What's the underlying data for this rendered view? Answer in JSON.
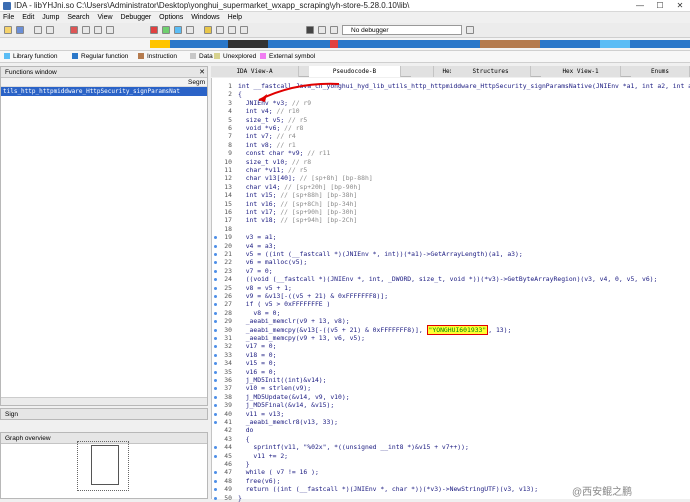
{
  "window": {
    "title": "IDA - libYHJni.so C:\\Users\\Administrator\\Desktop\\yonghui_supermarket_wxapp_scraping\\yh-store-5.28.0.10\\lib\\",
    "buttons": [
      "—",
      "☐",
      "✕"
    ]
  },
  "menu": [
    "File",
    "Edit",
    "Jump",
    "Search",
    "View",
    "Debugger",
    "Options",
    "Windows",
    "Help"
  ],
  "toolbar": {
    "debugger_select": "No debugger"
  },
  "legend": [
    {
      "label": "Library function",
      "color": "#5bbdf5"
    },
    {
      "label": "Regular function",
      "color": "#2a77c9"
    },
    {
      "label": "Instruction",
      "color": "#b57b4e"
    },
    {
      "label": "Data",
      "color": "#c8c8c8"
    },
    {
      "label": "Unexplored",
      "color": "#d6d18e"
    },
    {
      "label": "External symbol",
      "color": "#f17df2"
    }
  ],
  "functions_window": {
    "title": "Functions window",
    "column": "Segm",
    "selected": "tils_http_httpmiddware_HttpSecurity_signParamsNat"
  },
  "sign_window": {
    "title": "Sign"
  },
  "graph_overview": {
    "title": "Graph overview"
  },
  "tabs": [
    {
      "label": "IDA View-A",
      "active": false
    },
    {
      "label": "Pseudocode-B",
      "active": true
    },
    {
      "label": "Hex View-1",
      "active": false
    },
    {
      "label": "Structures",
      "active": false
    },
    {
      "label": "Enums",
      "active": false
    }
  ],
  "code_lines": [
    {
      "n": "1",
      "t": "int __fastcall Java_cn_yonghui_hyd_lib_utils_http_httpmiddware_HttpSecurity_signParamsNative(JNIEnv *a1, int a2, int a3)",
      "dot": false
    },
    {
      "n": "2",
      "t": "{",
      "dot": false
    },
    {
      "n": "3",
      "t": "  JNIEnv *v3; // r9",
      "dot": false
    },
    {
      "n": "4",
      "t": "  int v4; // r10",
      "dot": false
    },
    {
      "n": "5",
      "t": "  size_t v5; // r5",
      "dot": false
    },
    {
      "n": "6",
      "t": "  void *v6; // r8",
      "dot": false
    },
    {
      "n": "7",
      "t": "  int v7; // r4",
      "dot": false
    },
    {
      "n": "8",
      "t": "  int v8; // r1",
      "dot": false
    },
    {
      "n": "9",
      "t": "  const char *v9; // r11",
      "dot": false
    },
    {
      "n": "10",
      "t": "  size_t v10; // r8",
      "dot": false
    },
    {
      "n": "11",
      "t": "  char *v11; // r5",
      "dot": false
    },
    {
      "n": "12",
      "t": "  char v13[40]; // [sp+8h] [bp-88h]",
      "dot": false
    },
    {
      "n": "13",
      "t": "  char v14; // [sp+20h] [bp-90h]",
      "dot": false
    },
    {
      "n": "14",
      "t": "  int v15; // [sp+88h] [bp-38h]",
      "dot": false
    },
    {
      "n": "15",
      "t": "  int v16; // [sp+8Ch] [bp-34h]",
      "dot": false
    },
    {
      "n": "16",
      "t": "  int v17; // [sp+90h] [bp-30h]",
      "dot": false
    },
    {
      "n": "17",
      "t": "  int v18; // [sp+94h] [bp-2Ch]",
      "dot": false
    },
    {
      "n": "18",
      "t": "",
      "dot": false
    },
    {
      "n": "19",
      "t": "  v3 = a1;",
      "dot": true
    },
    {
      "n": "20",
      "t": "  v4 = a3;",
      "dot": true
    },
    {
      "n": "21",
      "t": "  v5 = ((int (__fastcall *)(JNIEnv *, int))(*a1)->GetArrayLength)(a1, a3);",
      "dot": true
    },
    {
      "n": "22",
      "t": "  v6 = malloc(v5);",
      "dot": true
    },
    {
      "n": "23",
      "t": "  v7 = 0;",
      "dot": true
    },
    {
      "n": "24",
      "t": "  ((void (__fastcall *)(JNIEnv *, int, _DWORD, size_t, void *))(*v3)->GetByteArrayRegion)(v3, v4, 0, v5, v6);",
      "dot": true
    },
    {
      "n": "25",
      "t": "  v8 = v5 + 1;",
      "dot": true
    },
    {
      "n": "26",
      "t": "  v9 = &v13[-((v5 + 21) & 0xFFFFFFF8)];",
      "dot": true
    },
    {
      "n": "27",
      "t": "  if ( v5 > 0xFFFFFFFE )",
      "dot": true
    },
    {
      "n": "28",
      "t": "    v8 = 0;",
      "dot": true
    },
    {
      "n": "29",
      "t": "  _aeabi_memclr(v9 + 13, v8);",
      "dot": true
    },
    {
      "n": "30",
      "t": "  _aeabi_memcpy(&v13[-((v5 + 21) & 0xFFFFFFF8)], ",
      "dot": true,
      "hl": "\"YONGHUI601933\"",
      "after": ", 13);"
    },
    {
      "n": "31",
      "t": "  _aeabi_memcpy(v9 + 13, v6, v5);",
      "dot": true
    },
    {
      "n": "32",
      "t": "  v17 = 0;",
      "dot": true
    },
    {
      "n": "33",
      "t": "  v18 = 0;",
      "dot": true
    },
    {
      "n": "34",
      "t": "  v15 = 0;",
      "dot": true
    },
    {
      "n": "35",
      "t": "  v16 = 0;",
      "dot": true
    },
    {
      "n": "36",
      "t": "  j_MD5Init((int)&v14);",
      "dot": true
    },
    {
      "n": "37",
      "t": "  v10 = strlen(v9);",
      "dot": true
    },
    {
      "n": "38",
      "t": "  j_MD5Update(&v14, v9, v10);",
      "dot": true
    },
    {
      "n": "39",
      "t": "  j_MD5Final(&v14, &v15);",
      "dot": true
    },
    {
      "n": "40",
      "t": "  v11 = v13;",
      "dot": true
    },
    {
      "n": "41",
      "t": "  _aeabi_memclr8(v13, 33);",
      "dot": true
    },
    {
      "n": "42",
      "t": "  do",
      "dot": false
    },
    {
      "n": "43",
      "t": "  {",
      "dot": false
    },
    {
      "n": "44",
      "t": "    sprintf(v11, \"%02x\", *((unsigned __int8 *)&v15 + v7++));",
      "dot": true
    },
    {
      "n": "45",
      "t": "    v11 += 2;",
      "dot": true
    },
    {
      "n": "46",
      "t": "  }",
      "dot": false
    },
    {
      "n": "47",
      "t": "  while ( v7 != 16 );",
      "dot": true
    },
    {
      "n": "48",
      "t": "  free(v6);",
      "dot": true
    },
    {
      "n": "49",
      "t": "  return ((int (__fastcall *)(JNIEnv *, char *))(*v3)->NewStringUTF)(v3, v13);",
      "dot": true
    },
    {
      "n": "50",
      "t": "}",
      "dot": true
    }
  ],
  "watermark": "@西安鲲之鹏"
}
